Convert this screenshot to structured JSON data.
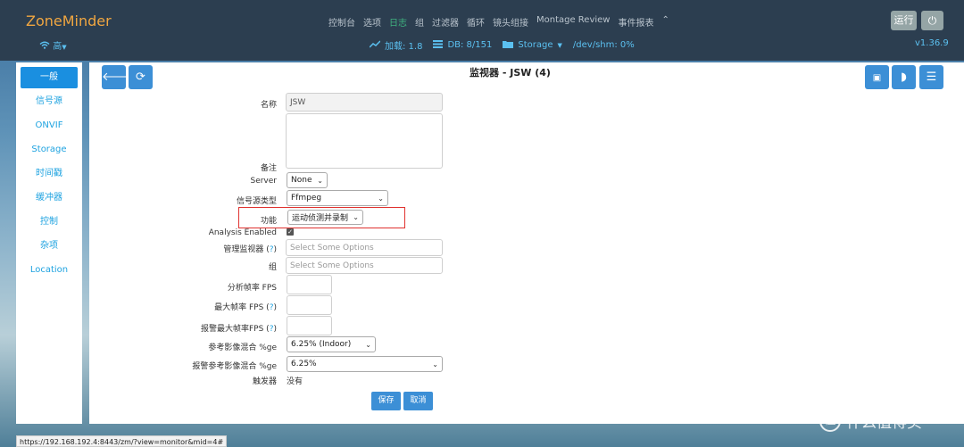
{
  "app": {
    "brand": "ZoneMinder",
    "version": "v1.36.9"
  },
  "navbar": {
    "wifi_label": "高",
    "menu": [
      {
        "label": "控制台"
      },
      {
        "label": "选项"
      },
      {
        "label": "日志",
        "active": true
      },
      {
        "label": "组"
      },
      {
        "label": "过滤器"
      },
      {
        "label": "循环"
      },
      {
        "label": "镜头组接"
      },
      {
        "label": "Montage Review"
      },
      {
        "label": "事件报表"
      }
    ],
    "run_label": "运行",
    "status": {
      "load": "加载: 1.8",
      "db": "DB: 8/151",
      "storage": "Storage",
      "shm": "/dev/shm: 0%"
    }
  },
  "sidebar": {
    "items": [
      {
        "label": "一般",
        "active": true
      },
      {
        "label": "信号源"
      },
      {
        "label": "ONVIF"
      },
      {
        "label": "Storage"
      },
      {
        "label": "时间戳"
      },
      {
        "label": "缓冲器"
      },
      {
        "label": "控制"
      },
      {
        "label": "杂项"
      },
      {
        "label": "Location"
      }
    ]
  },
  "main": {
    "title": "监视器 - JSW (4)",
    "form": {
      "name_label": "名称",
      "name_value": "JSW",
      "notes_label": "备注",
      "server_label": "Server",
      "server_value": "None",
      "source_type_label": "信号源类型",
      "source_type_value": "Ffmpeg",
      "function_label": "功能",
      "function_value": "运动侦测并录制",
      "analysis_label": "Analysis Enabled",
      "linked_label": "管理监视器 (",
      "linked_placeholder": "Select Some Options",
      "groups_label": "组",
      "groups_placeholder": "Select Some Options",
      "analysis_fps_label": "分析帧率 FPS",
      "max_fps_label": "最大帧率 FPS (",
      "alarm_fps_label": "报警最大帧率FPS (",
      "ref_blend_label": "参考影像混合 %ge",
      "ref_blend_value": "6.25% (Indoor)",
      "alarm_ref_blend_label": "报警参考影像混合 %ge",
      "alarm_ref_blend_value": "6.25%",
      "triggers_label": "触发器",
      "triggers_value": "没有",
      "help_mark": "?",
      "help_close": ")"
    },
    "save_label": "保存",
    "cancel_label": "取消"
  },
  "statusbar_url": "https://192.168.192.4:8443/zm/?view=monitor&mid=4#",
  "watermark": {
    "text": "什么值得买",
    "logo": "值"
  }
}
